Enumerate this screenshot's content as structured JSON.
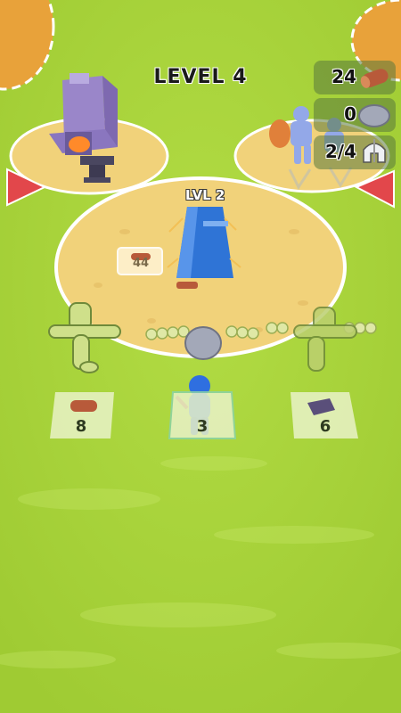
{
  "hud": {
    "level_title": "LEVEL 4",
    "resources": [
      {
        "name": "wood",
        "count": "24",
        "icon": "log-icon"
      },
      {
        "name": "stone",
        "count": "0",
        "icon": "stone-icon"
      },
      {
        "name": "army",
        "count": "2/4",
        "icon": "spartan-helmet-icon"
      }
    ]
  },
  "camp": {
    "level_label": "LVL 2",
    "upgrade_cost": "44",
    "upgrade_cost_icon": "log-icon"
  },
  "resource_tiles": [
    {
      "name": "wood-pile",
      "count": "8",
      "icon": "log-icon"
    },
    {
      "name": "stone-pile",
      "count": "3",
      "icon": "stone-icon"
    },
    {
      "name": "ore-pile",
      "count": "6",
      "icon": "ore-icon"
    }
  ],
  "colors": {
    "grass": "#a9d43c",
    "sand": "#f1d27a",
    "player": "#2f6fe0",
    "arrow": "#e2474b"
  }
}
